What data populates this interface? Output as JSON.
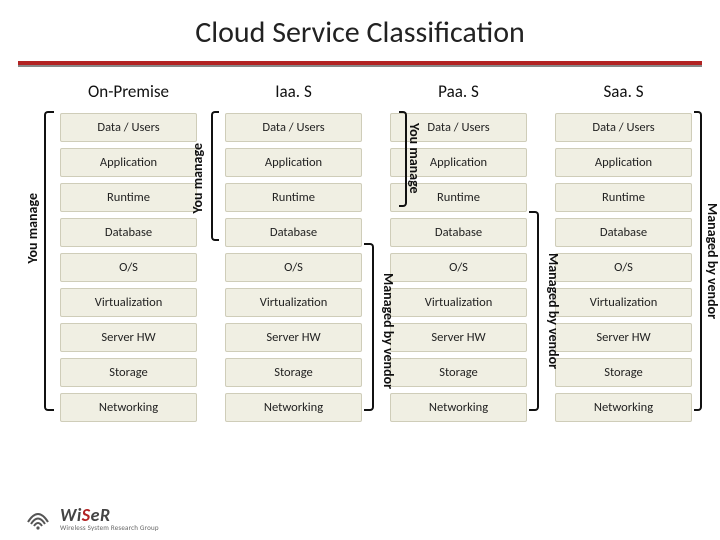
{
  "title": "Cloud Service Classification",
  "labels": {
    "you_manage": "You manage",
    "managed_by_vendor": "Managed by vendor"
  },
  "layers": [
    "Data / Users",
    "Application",
    "Runtime",
    "Database",
    "O/S",
    "Virtualization",
    "Server HW",
    "Storage",
    "Networking"
  ],
  "models": [
    {
      "name": "On-Premise",
      "you_manage_count": 9
    },
    {
      "name": "Iaa. S",
      "you_manage_count": 4
    },
    {
      "name": "Paa. S",
      "you_manage_count": 3
    },
    {
      "name": "Saa. S",
      "you_manage_count": 0
    }
  ],
  "footer": {
    "brand_html": "WiSeR",
    "brand_red_index": 2,
    "subtitle": "Wireless System Research Group"
  },
  "chart_data": {
    "type": "table",
    "title": "Cloud Service Classification",
    "columns": [
      "On-Premise",
      "Iaa. S",
      "Paa. S",
      "Saa. S"
    ],
    "rows": [
      "Data / Users",
      "Application",
      "Runtime",
      "Database",
      "O/S",
      "Virtualization",
      "Server HW",
      "Storage",
      "Networking"
    ],
    "cells_managed_by_you": [
      [
        true,
        true,
        true,
        false
      ],
      [
        true,
        true,
        true,
        false
      ],
      [
        true,
        true,
        true,
        false
      ],
      [
        true,
        true,
        false,
        false
      ],
      [
        true,
        false,
        false,
        false
      ],
      [
        true,
        false,
        false,
        false
      ],
      [
        true,
        false,
        false,
        false
      ],
      [
        true,
        false,
        false,
        false
      ],
      [
        true,
        false,
        false,
        false
      ]
    ],
    "legend": [
      "You manage",
      "Managed by vendor"
    ]
  }
}
